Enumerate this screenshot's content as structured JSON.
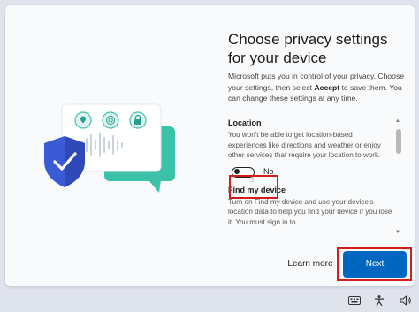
{
  "header": {
    "title": "Choose privacy settings for your device"
  },
  "intro": {
    "text_before": "Microsoft puts you in control of your privacy. Choose your settings, then select ",
    "bold_word": "Accept",
    "text_after": " to save them. You can change these settings at any time."
  },
  "sections": {
    "location": {
      "title": "Location",
      "description": "You won't be able to get location-based experiences like directions and weather or enjoy other services that require your location to work.",
      "toggle_label": "No",
      "toggle_on": false
    },
    "find_my_device": {
      "title": "Find my device",
      "description": "Turn on Find my device and use your device's location data to help you find your device if you lose it. You must sign in to"
    }
  },
  "buttons": {
    "learn_more": "Learn more",
    "next": "Next"
  },
  "colors": {
    "accent": "#0067c0",
    "highlight": "#d41c1c",
    "shield": "#3b5bd6",
    "bubble": "#3bc2a8"
  },
  "illustration_icons": [
    "location-pin-icon",
    "fingerprint-icon",
    "lock-icon",
    "shield-check-icon"
  ],
  "taskbar_icons": [
    "keyboard-icon",
    "accessibility-icon",
    "volume-icon"
  ]
}
